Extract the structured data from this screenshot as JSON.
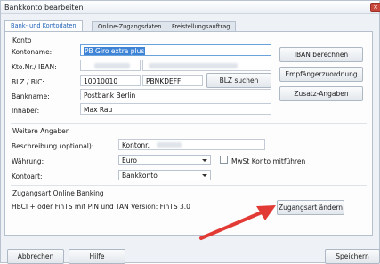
{
  "window": {
    "title": "Bankkonto bearbeiten",
    "close_glyph": "×"
  },
  "tabs": [
    {
      "label": "Bank- und Kontodaten",
      "active": true
    },
    {
      "label": "Online-Zugangsdaten",
      "active": false
    },
    {
      "label": "Freistellungsauftrag",
      "active": false
    }
  ],
  "konto": {
    "group_label": "Konto",
    "kontoname_label": "Kontoname:",
    "kontoname_value": "PB Giro extra plus",
    "ktonr_label": "Kto.Nr./ IBAN:",
    "blz_label": "BLZ / BIC:",
    "blz_value": "10010010",
    "bic_value": "PBNKDEFF",
    "blz_search_button": "BLZ suchen",
    "bankname_label": "Bankname:",
    "bankname_value": "Postbank Berlin",
    "inhaber_label": "Inhaber:",
    "inhaber_value": "Max Rau"
  },
  "side_buttons": {
    "iban": "IBAN berechnen",
    "empfaenger": "Empfängerzuordnung",
    "zusatz": "Zusatz-Angaben"
  },
  "weitere": {
    "group_label": "Weitere Angaben",
    "beschreibung_label": "Beschreibung (optional):",
    "beschreibung_value": "Kontonr. ",
    "waehrung_label": "Währung:",
    "waehrung_value": "Euro",
    "mwst_label": "MwSt Konto mitführen",
    "kontoart_label": "Kontoart:",
    "kontoart_value": "Bankkonto"
  },
  "zugang": {
    "group_label": "Zugangsart Online Banking",
    "info_text": "HBCI + oder FinTS mit PIN und TAN   Version: FinTS 3.0",
    "change_button": "Zugangsart ändern"
  },
  "footer": {
    "abbrechen": "Abbrechen",
    "hilfe": "Hilfe",
    "speichern": "Speichern"
  },
  "colors": {
    "accent_arrow": "#e23b36",
    "selection": "#3d83d6"
  }
}
